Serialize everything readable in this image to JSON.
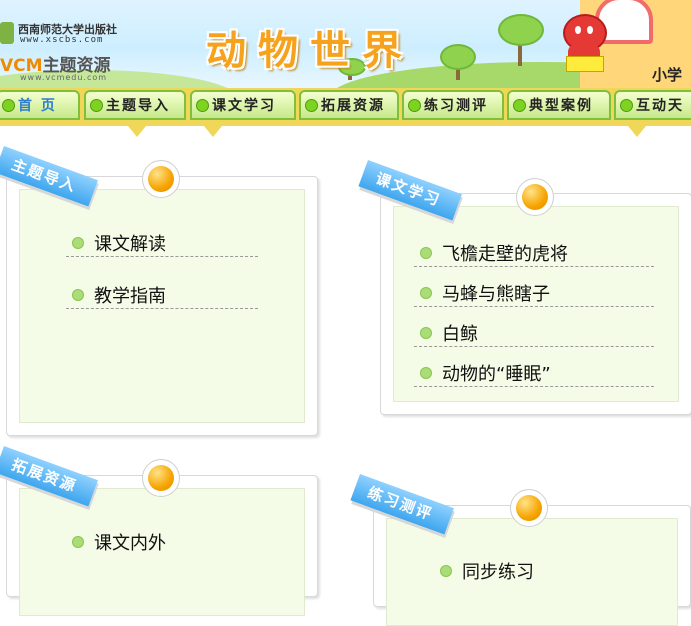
{
  "header": {
    "publisher": "西南师范大学出版社",
    "publisher_url": "www.xscbs.com",
    "brand": "VCM",
    "brand_suffix": "主题资源",
    "brand_url": "www.vcmedu.com",
    "title": "动物世界",
    "level": "小学"
  },
  "nav": {
    "items": [
      {
        "label": "首  页"
      },
      {
        "label": "主题导入"
      },
      {
        "label": "课文学习"
      },
      {
        "label": "拓展资源"
      },
      {
        "label": "练习测评"
      },
      {
        "label": "典型案例"
      },
      {
        "label": "互动天"
      }
    ]
  },
  "cards": [
    {
      "tag": "主题导入",
      "links": [
        "课文解读",
        "教学指南"
      ]
    },
    {
      "tag": "课文学习",
      "links": [
        "飞檐走壁的虎将",
        "马蜂与熊瞎子",
        "白鲸",
        "动物的“睡眠”"
      ]
    },
    {
      "tag": "拓展资源",
      "links": [
        "课文内外"
      ]
    },
    {
      "tag": "练习测评",
      "links": [
        "同步练习"
      ]
    }
  ],
  "colors": {
    "accent": "#f7a21c",
    "nav_bar": "#f0d75a",
    "nav_tab_border": "#7fbf3a",
    "ribbon": "#3ea6ee",
    "card_fill": "#f4fbe6"
  },
  "icons": {
    "nav_bullet": "green-dot-icon",
    "card_pin": "orange-pin-icon",
    "item_bullet": "green-bullet-icon"
  }
}
